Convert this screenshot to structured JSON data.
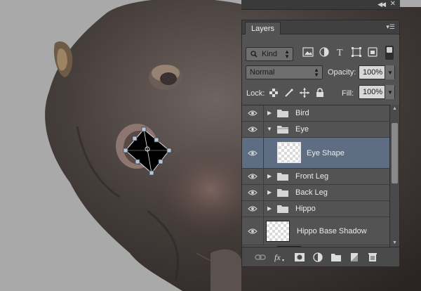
{
  "panel": {
    "title": "Layers",
    "filter": {
      "kind_label": "Kind"
    },
    "blend_mode": "Normal",
    "opacity_label": "Opacity:",
    "opacity_value": "100%",
    "lock_label": "Lock:",
    "fill_label": "Fill:",
    "fill_value": "100%"
  },
  "layers": [
    {
      "name": "Bird",
      "type": "group",
      "expanded": false
    },
    {
      "name": "Eye",
      "type": "group",
      "expanded": true
    },
    {
      "name": "Eye Shape",
      "type": "shape",
      "selected": true
    },
    {
      "name": "Front Leg",
      "type": "group",
      "expanded": false
    },
    {
      "name": "Back Leg",
      "type": "group",
      "expanded": false
    },
    {
      "name": "Hippo",
      "type": "group",
      "expanded": false
    },
    {
      "name": "Hippo Base Shadow",
      "type": "pixel"
    }
  ],
  "colors": {
    "selection": "#5f6d82",
    "panel": "#535353",
    "canvas_bg": "#a9a9a9"
  },
  "icons": [
    "visibility-eye-icon",
    "folder-icon",
    "link-layers-icon",
    "fx-icon",
    "mask-icon",
    "adjustment-icon",
    "new-group-icon",
    "new-layer-icon",
    "trash-icon"
  ]
}
